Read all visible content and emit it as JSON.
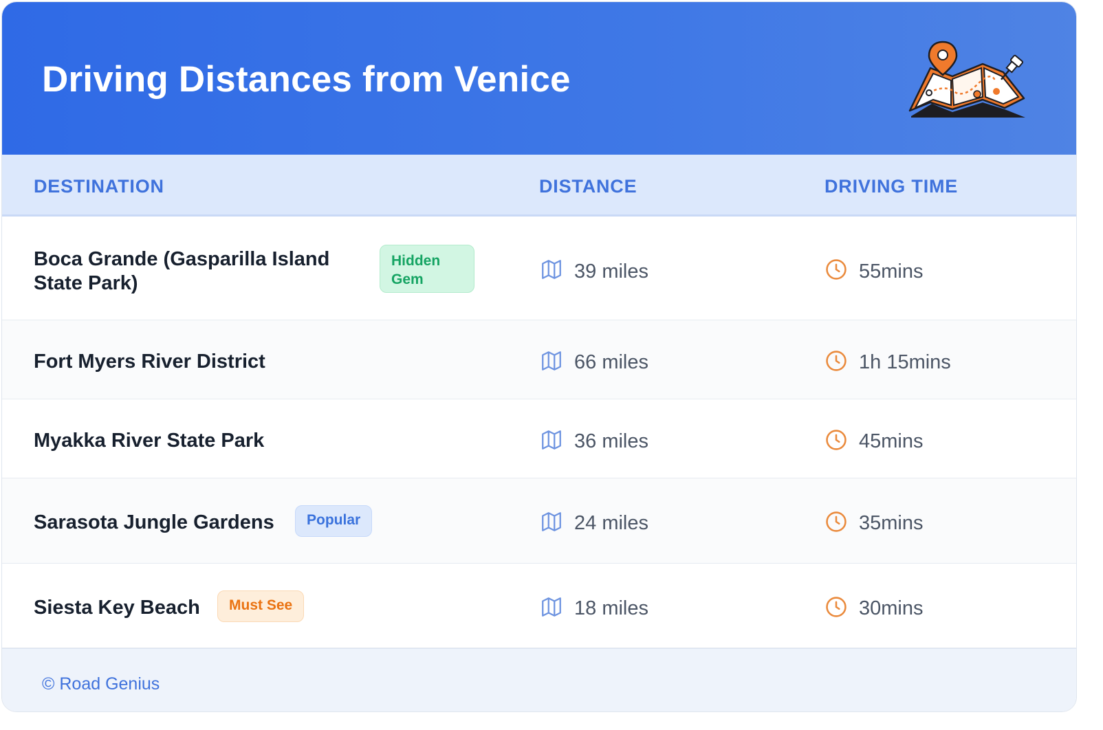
{
  "header": {
    "title": "Driving Distances from Venice"
  },
  "columns": {
    "destination": "DESTINATION",
    "distance": "DISTANCE",
    "driving_time": "DRIVING TIME"
  },
  "rows": [
    {
      "destination_line1": "Boca Grande (Gasparilla Island",
      "destination_line2": "State Park)",
      "badge_line1": "Hidden",
      "badge_line2": "Gem",
      "distance": "39 miles",
      "time": "55mins"
    },
    {
      "destination": "Fort Myers River District",
      "distance": "66 miles",
      "time": "1h 15mins"
    },
    {
      "destination": "Myakka River State Park",
      "distance": "36 miles",
      "time": "45mins"
    },
    {
      "destination": "Sarasota Jungle Gardens",
      "badge": "Popular",
      "distance": "24 miles",
      "time": "35mins"
    },
    {
      "destination": "Siesta Key Beach",
      "badge": "Must See",
      "distance": "18 miles",
      "time": "30mins"
    }
  ],
  "footer": {
    "credit": "© Road Genius"
  },
  "icons": {
    "distance": "map-icon",
    "time": "clock-icon",
    "illustration": "folded-map-with-pins-icon"
  },
  "colors": {
    "header_gradient_start": "#2f6ae6",
    "header_gradient_end": "#4f83e4",
    "accent_blue": "#3f72dc",
    "time_icon_orange": "#ea8a3c",
    "badge_hidden_gem": "#15a463",
    "badge_popular": "#3a72dc",
    "badge_must_see": "#ea7312"
  }
}
